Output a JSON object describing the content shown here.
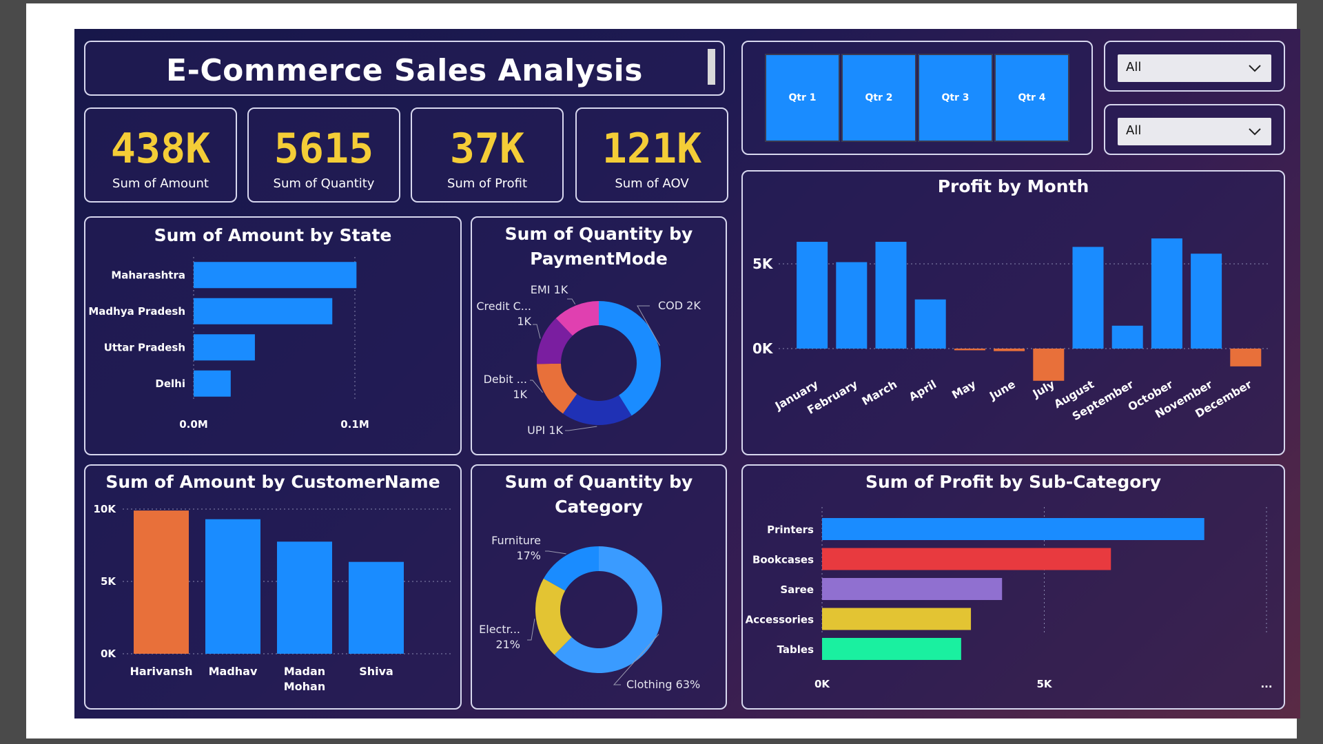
{
  "header": {
    "title": "E-Commerce Sales Analysis"
  },
  "kpis": [
    {
      "value": "438K",
      "label": "Sum of Amount"
    },
    {
      "value": "5615",
      "label": "Sum of Quantity"
    },
    {
      "value": "37K",
      "label": "Sum of Profit"
    },
    {
      "value": "121K",
      "label": "Sum of AOV"
    }
  ],
  "slicers": {
    "quarters": [
      "Qtr 1",
      "Qtr 2",
      "Qtr 3",
      "Qtr 4"
    ],
    "dropdown1": "All",
    "dropdown2": "All"
  },
  "colors": {
    "blue": "#1a8cff",
    "orange": "#e8703a",
    "magenta": "#e040b0",
    "purple": "#7a1ea0",
    "navy": "#1f31b5",
    "lightblue": "#3a9bff",
    "yellow": "#e3c433",
    "gold": "#f4cd37"
  },
  "chart_data": [
    {
      "id": "state",
      "type": "bar",
      "orientation": "horizontal",
      "title": "Sum of Amount by State",
      "categories": [
        "Maharashtra",
        "Madhya Pradesh",
        "Uttar Pradesh",
        "Delhi"
      ],
      "values": [
        101000,
        86000,
        38000,
        23000
      ],
      "xlim": [
        0,
        100000
      ],
      "tick_labels": [
        "0.0M",
        "0.1M"
      ],
      "tick_values": [
        0,
        100000
      ]
    },
    {
      "id": "payment",
      "type": "pie",
      "donut": true,
      "title": "Sum of Quantity by PaymentMode",
      "title_lines": [
        "Sum of Quantity by",
        "PaymentMode"
      ],
      "categories": [
        "COD",
        "UPI",
        "Debit Card",
        "Credit Card",
        "EMI"
      ],
      "values": [
        2200,
        1000,
        800,
        700,
        650
      ],
      "colors": [
        "#1a8cff",
        "#1f31b5",
        "#e8703a",
        "#7a1ea0",
        "#e040b0"
      ],
      "labels": [
        {
          "lines": [
            "COD 2K"
          ]
        },
        {
          "lines": [
            "UPI 1K"
          ]
        },
        {
          "lines": [
            "Debit ...",
            "1K"
          ]
        },
        {
          "lines": [
            "Credit C...",
            "1K"
          ]
        },
        {
          "lines": [
            "EMI 1K"
          ]
        }
      ]
    },
    {
      "id": "month",
      "type": "bar",
      "title": "Profit by Month",
      "categories": [
        "January",
        "February",
        "March",
        "April",
        "May",
        "June",
        "July",
        "August",
        "September",
        "October",
        "November",
        "December"
      ],
      "values": [
        6300,
        5100,
        6300,
        2900,
        -100,
        -150,
        -1900,
        6000,
        1350,
        6500,
        5600,
        -1050
      ],
      "ylim": [
        -2000,
        7000
      ],
      "tick_labels": [
        "0K",
        "5K"
      ],
      "tick_values": [
        0,
        5000
      ]
    },
    {
      "id": "customer",
      "type": "bar",
      "title": "Sum of Amount by CustomerName",
      "categories": [
        "Harivansh",
        "Madhav",
        "Madan Mohan",
        "Shiva"
      ],
      "category_lines": [
        [
          "Harivansh"
        ],
        [
          "Madhav"
        ],
        [
          "Madan",
          "Mohan"
        ],
        [
          "Shiva"
        ]
      ],
      "values": [
        9900,
        9300,
        7750,
        6350
      ],
      "colors": [
        "#e8703a",
        "#1a8cff",
        "#1a8cff",
        "#1a8cff"
      ],
      "ylim": [
        0,
        10000
      ],
      "tick_labels": [
        "0K",
        "5K",
        "10K"
      ],
      "tick_values": [
        0,
        5000,
        10000
      ]
    },
    {
      "id": "category",
      "type": "pie",
      "donut": true,
      "title": "Sum of Quantity by Category",
      "title_lines": [
        "Sum of Quantity by",
        "Category"
      ],
      "categories": [
        "Clothing",
        "Electronics",
        "Furniture"
      ],
      "values": [
        63,
        21,
        17
      ],
      "colors": [
        "#3a9bff",
        "#e3c433",
        "#1a8cff"
      ],
      "labels": [
        {
          "lines": [
            "Clothing 63%"
          ]
        },
        {
          "lines": [
            "Electr...",
            "21%"
          ]
        },
        {
          "lines": [
            "Furniture",
            "17%"
          ]
        }
      ]
    },
    {
      "id": "subcat",
      "type": "bar",
      "orientation": "horizontal",
      "title": "Sum of Profit by Sub-Category",
      "categories": [
        "Printers",
        "Bookcases",
        "Saree",
        "Accessories",
        "Tables"
      ],
      "values": [
        8600,
        6500,
        4050,
        3350,
        3130
      ],
      "colors": [
        "#1a8cff",
        "#e83a3f",
        "#9070d0",
        "#e3c433",
        "#1af0a0"
      ],
      "xlim": [
        0,
        10000
      ],
      "tick_labels": [
        "0K",
        "5K",
        "..."
      ],
      "tick_values": [
        0,
        5000,
        10000
      ]
    }
  ]
}
